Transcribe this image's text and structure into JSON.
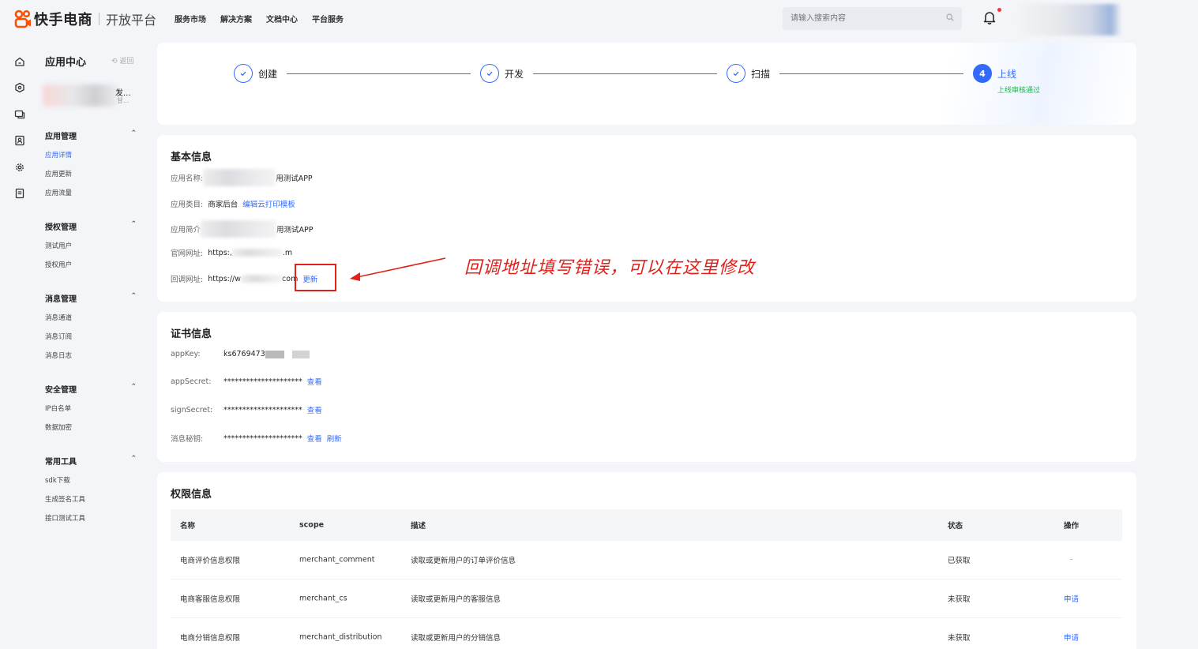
{
  "header": {
    "brand": "快手电商",
    "platform": "开放平台",
    "nav": [
      "服务市场",
      "解决方案",
      "文档中心",
      "平台服务"
    ],
    "search_placeholder": "请输入搜索内容"
  },
  "sidebar": {
    "title": "应用中心",
    "back": "返回",
    "app_name_tail": "发...",
    "app_sub_tail": "甘...",
    "groups": [
      {
        "title": "应用管理",
        "items": [
          "应用详情",
          "应用更新",
          "应用流量"
        ],
        "active": 0
      },
      {
        "title": "授权管理",
        "items": [
          "测试用户",
          "授权用户"
        ]
      },
      {
        "title": "消息管理",
        "items": [
          "消息通道",
          "消息订阅",
          "消息日志"
        ]
      },
      {
        "title": "安全管理",
        "items": [
          "IP白名单",
          "数据加密"
        ]
      },
      {
        "title": "常用工具",
        "items": [
          "sdk下载",
          "生成签名工具",
          "接口测试工具"
        ]
      }
    ]
  },
  "steps": [
    {
      "label": "创建",
      "state": "done"
    },
    {
      "label": "开发",
      "state": "done"
    },
    {
      "label": "扫描",
      "state": "done"
    },
    {
      "label": "上线",
      "state": "current",
      "number": "4",
      "sub": "上线审核通过"
    }
  ],
  "basic": {
    "title": "基本信息",
    "app_name_key": "应用名称:",
    "app_name_val": "用测试APP",
    "category_key": "应用类目:",
    "category_val": "商家后台",
    "category_link": "编辑云打印模板",
    "intro_key": "应用简介",
    "intro_val": "用测试APP",
    "site_key": "官网网址:",
    "site_val_a": "https:,",
    "site_val_b": ".m",
    "callback_key": "回调网址:",
    "callback_val_a": "https://w",
    "callback_val_b": "com",
    "callback_link": "更新"
  },
  "annotation": "回调地址填写错误，可以在这里修改",
  "cert": {
    "title": "证书信息",
    "appkey_key": "appKey:",
    "appkey_val": "ks6769473",
    "appsecret_key": "appSecret:",
    "signsecret_key": "signSecret:",
    "msgkey_key": "消息秘钥:",
    "masked": "*********************",
    "view": "查看",
    "refresh": "刷新"
  },
  "perm": {
    "title": "权限信息",
    "columns": [
      "名称",
      "scope",
      "描述",
      "状态",
      "操作"
    ],
    "rows": [
      {
        "name": "电商评价信息权限",
        "scope": "merchant_comment",
        "desc": "读取或更新用户的订单评价信息",
        "status": "已获取",
        "op": "-"
      },
      {
        "name": "电商客服信息权限",
        "scope": "merchant_cs",
        "desc": "读取或更新用户的客服信息",
        "status": "未获取",
        "op": "申请"
      },
      {
        "name": "电商分销信息权限",
        "scope": "merchant_distribution",
        "desc": "读取或更新用户的分销信息",
        "status": "未获取",
        "op": "申请"
      }
    ]
  },
  "colors": {
    "accent": "#326bfb",
    "success": "#19b84c",
    "annotation": "#e2211b"
  }
}
